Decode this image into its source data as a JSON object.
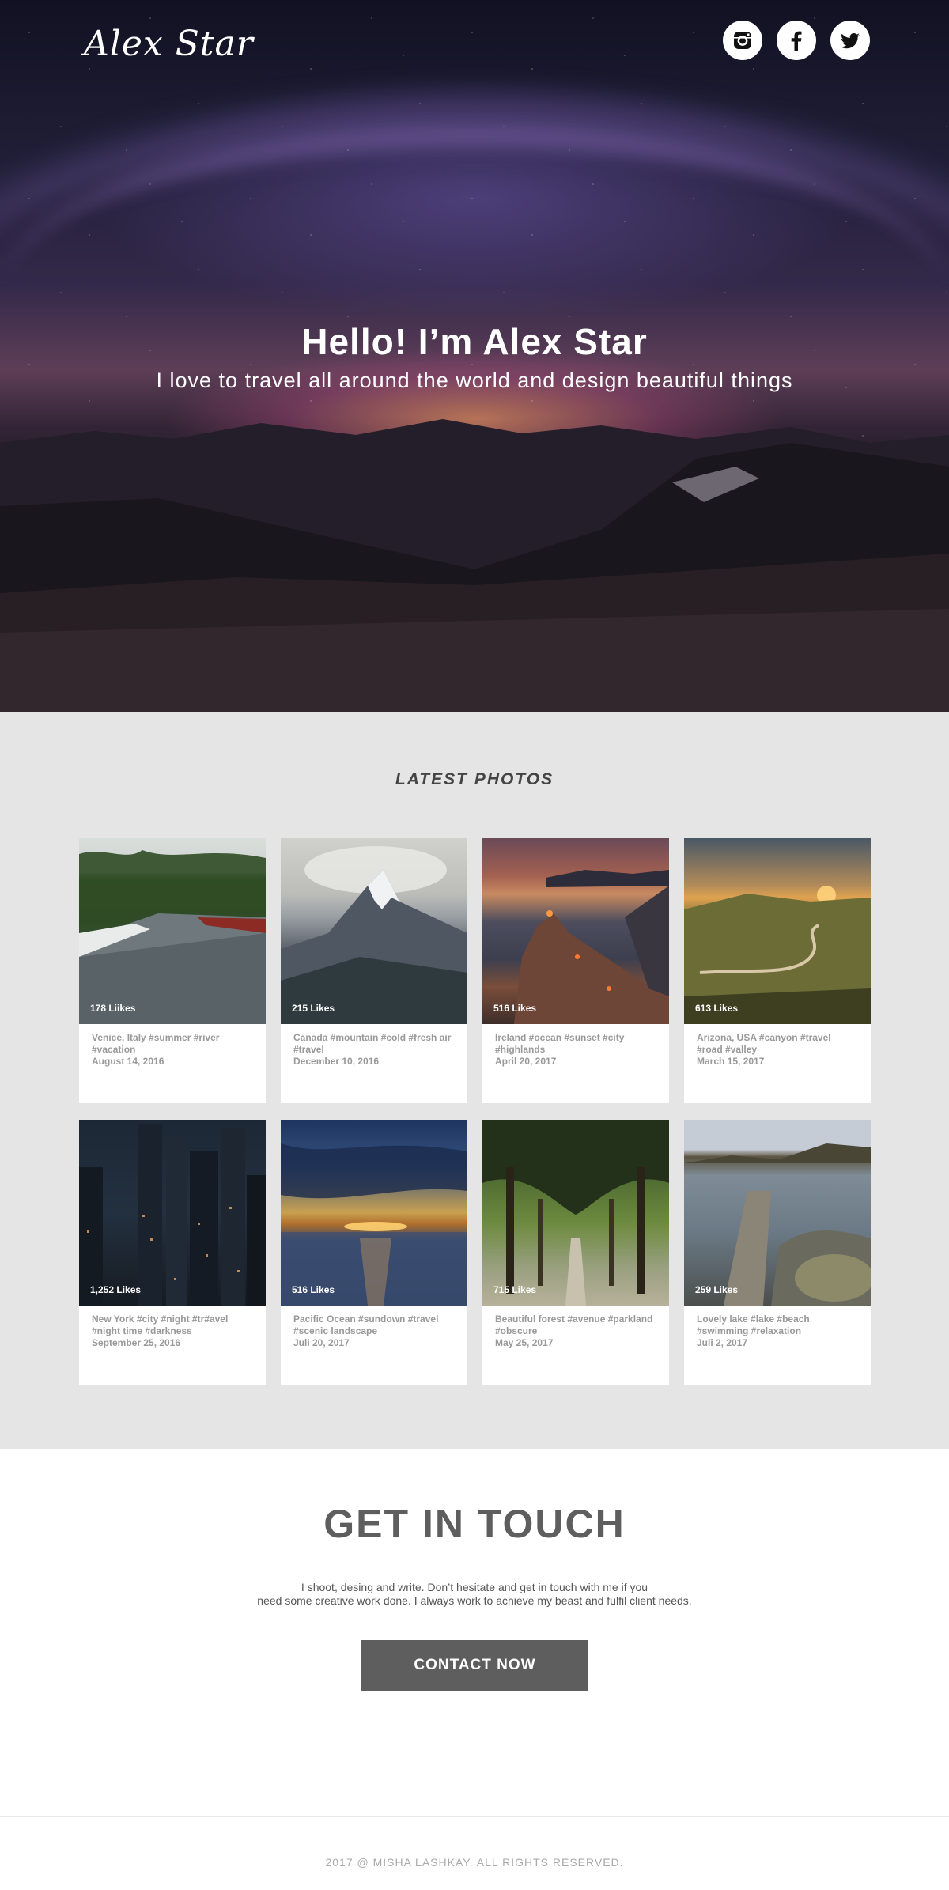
{
  "header": {
    "logo": "Alex Star",
    "socials": [
      {
        "icon": "instagram-icon"
      },
      {
        "icon": "facebook-icon"
      },
      {
        "icon": "twitter-icon"
      }
    ]
  },
  "hero": {
    "title": "Hello! I’m Alex Star",
    "subtitle": "I love to travel all around the world and design beautiful things"
  },
  "latest": {
    "title": "LATEST PHOTOS",
    "photos": [
      {
        "likes": "178 Liikes",
        "tags_line1": "Venice, Italy #summer #river",
        "tags_line2": "#vacation",
        "date": "August 14, 2016"
      },
      {
        "likes": "215 Likes",
        "tags_line1": "Canada #mountain #cold #fresh air",
        "tags_line2": "#travel",
        "date": "December 10, 2016"
      },
      {
        "likes": "516 Likes",
        "tags_line1": "Ireland #ocean #sunset #city",
        "tags_line2": "#highlands",
        "date": "April 20, 2017"
      },
      {
        "likes": "613 Likes",
        "tags_line1": "Arizona, USA #canyon #travel",
        "tags_line2": "#road #valley",
        "date": "March 15, 2017"
      },
      {
        "likes": "1,252 Likes",
        "tags_line1": "New York #city #night #tr#avel",
        "tags_line2": "#night time #darkness",
        "date": "September 25, 2016"
      },
      {
        "likes": "516 Likes",
        "tags_line1": "Pacific Ocean #sundown #travel",
        "tags_line2": "#scenic landscape",
        "date": "Juli 20, 2017"
      },
      {
        "likes": "715 Likes",
        "tags_line1": "Beautiful forest #avenue #parkland",
        "tags_line2": "#obscure",
        "date": "May 25, 2017"
      },
      {
        "likes": "259 Likes",
        "tags_line1": "Lovely lake #lake #beach",
        "tags_line2": "#swimming #relaxation",
        "date": "Juli 2, 2017"
      }
    ]
  },
  "touch": {
    "title": "GET IN TOUCH",
    "text_line1": "I shoot, desing and write. Don’t hesitate and get in touch with me if you",
    "text_line2": "need some creative work done. I always work to achieve my beast  and fulfil  client needs.",
    "button": "CONTACT NOW"
  },
  "footer": {
    "copyright": "2017 @ MISHA LASHKAY. ALL RIGHTS RESERVED."
  }
}
